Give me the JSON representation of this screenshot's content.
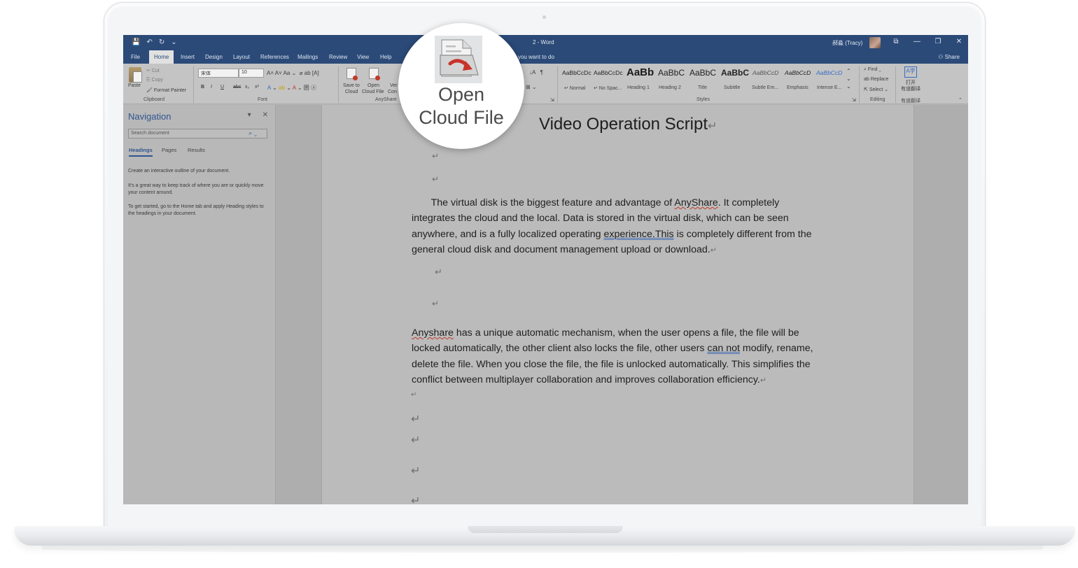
{
  "window": {
    "title": "2 - Word",
    "user": "郝淼 (Tracy)",
    "qat": [
      "💾",
      "↶",
      "↻",
      "⌄"
    ],
    "controls": [
      "⧉",
      "—",
      "❐",
      "✕"
    ]
  },
  "menu": {
    "tabs": [
      "File",
      "Home",
      "Insert",
      "Design",
      "Layout",
      "References",
      "Mailings",
      "Review",
      "View",
      "Help"
    ],
    "active": "Home",
    "tell_me": "at you want to do",
    "share": "Share"
  },
  "ribbon": {
    "clipboard": {
      "paste": "Paste",
      "cut": "Cut",
      "copy": "Copy",
      "format_painter": "Format Painter",
      "label": "Clipboard"
    },
    "font": {
      "name": "宋体",
      "size": "10",
      "label": "Font",
      "bold": "B",
      "italic": "I",
      "underline": "U",
      "strike": "abc",
      "sub": "x₂",
      "sup": "x²"
    },
    "anyshare": {
      "save_to_cloud": [
        "Save to",
        "Cloud"
      ],
      "open_cloud_file": [
        "Open",
        "Cloud File"
      ],
      "version": [
        "Ver",
        "Con"
      ],
      "label": "AnyShare"
    },
    "styles": {
      "label": "Styles",
      "items": [
        {
          "sample": "AaBbCcDc",
          "name": "↵ Normal"
        },
        {
          "sample": "AaBbCcDc",
          "name": "↵ No Spac..."
        },
        {
          "sample": "AaBb",
          "name": "Heading 1"
        },
        {
          "sample": "AaBbC",
          "name": "Heading 2"
        },
        {
          "sample": "AaBbC",
          "name": "Title"
        },
        {
          "sample": "AaBbC",
          "name": "Subtitle"
        },
        {
          "sample": "AaBbCcD",
          "name": "Subtle Em..."
        },
        {
          "sample": "AaBbCcD",
          "name": "Emphasis"
        },
        {
          "sample": "AaBbCcD",
          "name": "Intense E..."
        }
      ]
    },
    "editing": {
      "find": "Find",
      "replace": "Replace",
      "select": "Select",
      "label": "Editing"
    },
    "translate": {
      "line1": "打开",
      "line2": "有道翻译",
      "label": "有道翻译"
    }
  },
  "navigation": {
    "title": "Navigation",
    "search_placeholder": "Search document",
    "tabs": [
      "Headings",
      "Pages",
      "Results"
    ],
    "active_tab": "Headings",
    "paragraphs": [
      "Create an interactive outline of your document.",
      "It's a great way to keep track of where you are or quickly move your content around.",
      "To get started, go to the Home tab and apply Heading styles to the headings in your document."
    ]
  },
  "document": {
    "title": "Video Operation Script",
    "para1": {
      "indent": "The virtual disk is the biggest feature and advantage of ",
      "anyshare": "AnyShare",
      "rest1": ". It completely integrates the cloud and the local.  Data is stored in the virtual disk, which can be seen anywhere, and is a fully localized operating ",
      "experience": "experience.This",
      "rest2": " is completely different from the general cloud disk and document management upload or download."
    },
    "para2": {
      "anyshare": "Anyshare",
      "rest1": " has a unique automatic mechanism, when the user opens a file, the file will be locked automatically, the other client also locks the file, other users ",
      "cannot": "can not",
      "rest2": " modify, rename, delete the file. When you close the file, the file is unlocked automatically. This simplifies the conflict between multiplayer collaboration and improves collaboration efficiency."
    },
    "paragraph_mark": "↵"
  },
  "callout": {
    "line1": "Open",
    "line2": "Cloud File"
  }
}
